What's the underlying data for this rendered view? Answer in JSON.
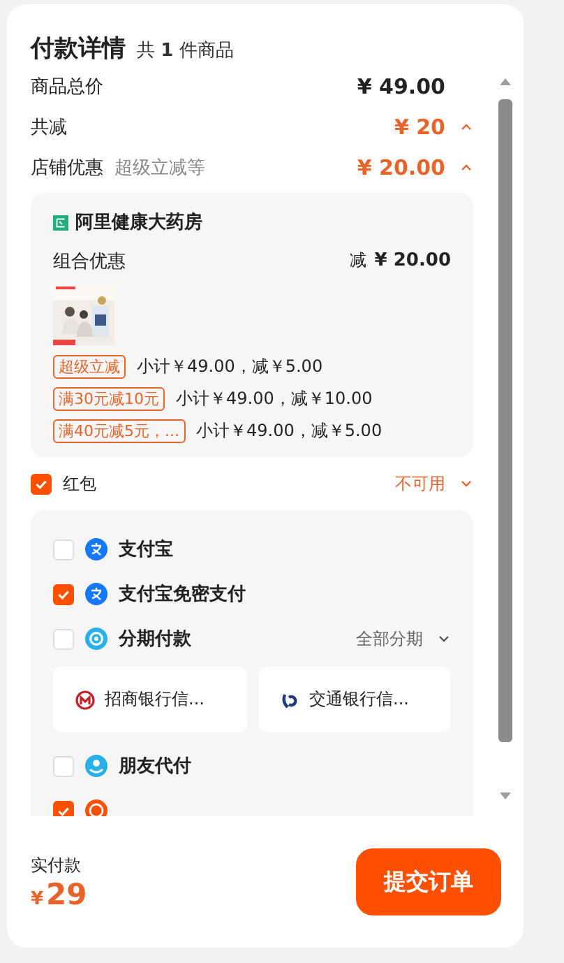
{
  "header": {
    "title": "付款详情",
    "count": "共 **1** 件商品"
  },
  "summary": [
    {
      "label": "商品总价",
      "value": "¥ 49.00",
      "highlight": false
    },
    {
      "label": "共减",
      "value": "¥ 20",
      "highlight": true,
      "expanded": true
    },
    {
      "label": "店铺优惠",
      "note": "超级立减等",
      "value": "¥ 20.00",
      "highlight": true,
      "expanded": true
    }
  ],
  "store": {
    "name": "阿里健康大药房",
    "promo_label": "组合优惠",
    "promo_prefix": "减",
    "promo_value": "¥ 20.00",
    "discounts": [
      {
        "tag": "超级立减",
        "text": "小计￥49.00，减￥5.00"
      },
      {
        "tag": "满30元减10元",
        "text": "小计￥49.00，减￥10.00"
      },
      {
        "tag": "满40元减5元，...",
        "text": "小计￥49.00，减￥5.00"
      }
    ]
  },
  "red_packet": {
    "label": "红包",
    "checked": true,
    "status": "不可用",
    "expanded": false
  },
  "payments": [
    {
      "name": "支付宝",
      "checked": false,
      "kind": "alipay"
    },
    {
      "name": "支付宝免密支付",
      "checked": true,
      "kind": "alipay"
    },
    {
      "name": "分期付款",
      "checked": false,
      "kind": "installment",
      "option": "全部分期",
      "banks": [
        {
          "name": "招商银行信...",
          "kind": "cmb"
        },
        {
          "name": "交通银行信...",
          "kind": "bocom"
        }
      ]
    },
    {
      "name": "朋友代付",
      "checked": false,
      "kind": "friend"
    },
    {
      "checked": true,
      "kind": "clock"
    }
  ],
  "footer": {
    "label": "实付款",
    "currency": "¥",
    "amount": "29",
    "button": "提交订单"
  }
}
